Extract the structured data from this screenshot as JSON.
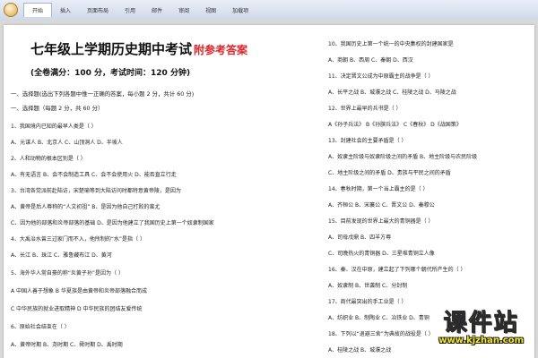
{
  "ribbon": {
    "tabs": [
      "开始",
      "插入",
      "页面布局",
      "引用",
      "邮件",
      "审阅",
      "视图",
      "加载项"
    ]
  },
  "doc": {
    "title": "七年级上学期历史期中考试",
    "title_suffix": "附参考答案",
    "subtitle": "(全卷满分：100 分，考试时间：120 分钟)",
    "left_lines": [
      "一、选择题(选出下列各题中惟一正确的答案，每小题 2 分，共计 60 分)",
      "一、选择题（每题 2 分，共 60 分）",
      "1、我国境内已知的最早人类是（        ）",
      "A、元谋人        B、北京人        C、山顶洞人        D、半坡人",
      "2、人和动物的根本区别是（        ）",
      "A、有无语言      B、会不会制造工具    C、会不会使用火    D、能否直立行走",
      "3、台湾各党派前赴陆访，宋楚瑜等到大陆访问时都特意黄帝陵，是因为",
      "A、黄帝是后人尊称的“人文初祖”      B、是因为他自己打败的蚩尤",
      "C、因为他的部落和炎帝部落的基础      D、是因为他建立了我国历史上第一个奴隶制国家",
      "4、大禹治水曾三过家门而不入，他所制的“水”是指（        ）",
      "A、长江         B、珠江         C、雅鲁藏布江        D、黄河",
      "5、海外华人常自豪的称“炎黄子孙”是因为（        ）",
      "A 中国人善于想象         B 华夏族是由黄帝和炎帝部落融合而成",
      "C 中华民族的就业进取精神        D 中华民族的团结友爱传统",
      "6、原始社会结束在（        ）",
      "A、黄帝时期        B、尧时期        C、舜时期        D、禹时期"
    ],
    "right_lines": [
      "10、我国历史上第一个统一的中央集权的封建国家是",
      "A、商朝       B、西周       C、秦朝       D、西汉",
      "11、决定晋文公成为中原霸主的战争是（    ）",
      "A、长平之战       B、城濮之战       C、桂陵之战       D、马陵之战",
      "12、世界上最早的兵书是（    ）",
      "A《孙子兵法》   B《孙膑兵法》   C《春秋》   D《战国策》",
      "13、封建社会的主要矛盾是（    ）",
      "A、奴隶主阶级与奴隶阶级之间的矛盾    B、地主阶级与农民阶级",
      "C、地主阶级之间的矛盾             D、贵族与平民之间的矛盾",
      "14、春秋时期，第一个当上霸主的是（    ）",
      "A、齐桓公     B、宋襄公     C、晋文公     D、秦穆公",
      "15、目前发现的世界上最大的青铜器是（    ）",
      "A、司母戊鼎                B、四羊方尊",
      "C、司晚热火的青铜器          D、三星堆青铜立人像",
      "16、秦、汉在中原，建立起了下列哪个朝代所产生的（    ）",
      "A、奴隶制     B、世袭制     C、分封制",
      "17、商代最突出的手工业是（    ）",
      "A、纺织业     B、制陶业     C、冶铁业     D、青铜",
      "18、下列以“退避三舍”为典故的战役是（    ）",
      "A、桂陵之战     B、城濮之战"
    ]
  },
  "watermark": {
    "main": "课件站",
    "url": "www.kjzhan.com"
  }
}
